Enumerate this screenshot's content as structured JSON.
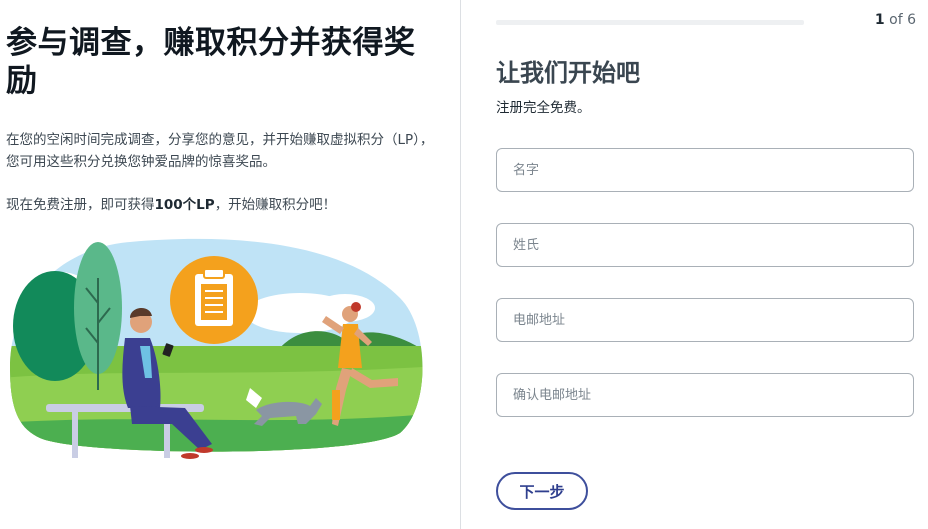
{
  "intro": {
    "headline": "参与调查，赚取积分并获得奖励",
    "description1": "在您的空闲时间完成调查，分享您的意见，并开始赚取虚拟积分（LP），您可用这些积分兑换您钟爱品牌的惊喜奖品。",
    "description2_prefix": "现在免费注册，即可获得",
    "description2_bold": "100个LP",
    "description2_suffix": "，开始赚取积分吧！"
  },
  "progress": {
    "current": "1",
    "of_label": "of",
    "total": "6",
    "fraction": 0.0
  },
  "form": {
    "title": "让我们开始吧",
    "subtitle": "注册完全免费。",
    "first_name_placeholder": "名字",
    "last_name_placeholder": "姓氏",
    "email_placeholder": "电邮地址",
    "confirm_email_placeholder": "确认电邮地址",
    "next_label": "下一步"
  },
  "colors": {
    "accent": "#3e4f9c",
    "clipboard_orange": "#f4a11d",
    "grass": "#7cc242"
  }
}
